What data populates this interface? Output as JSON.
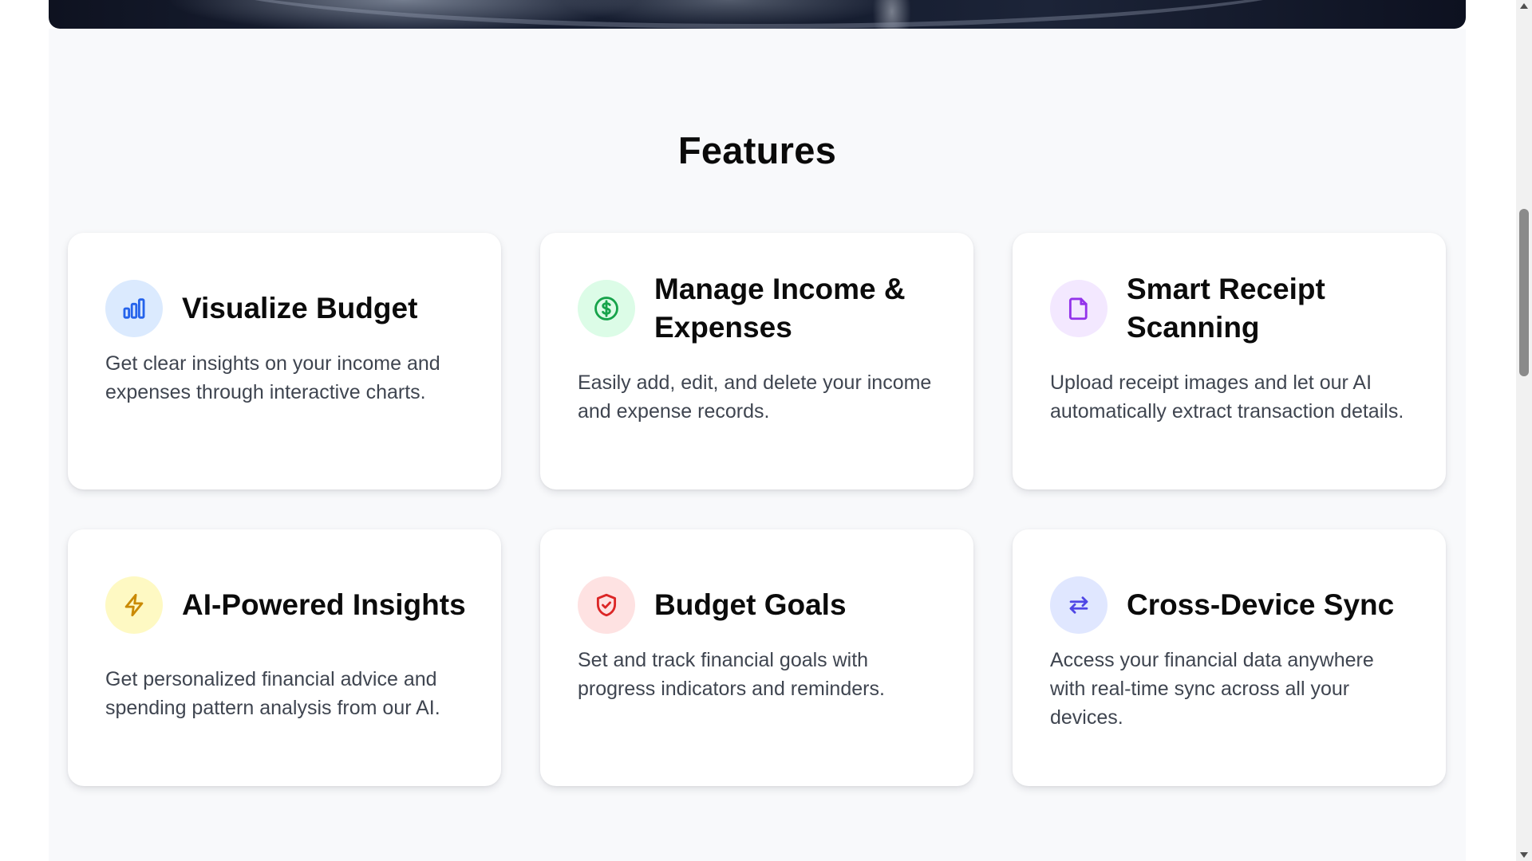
{
  "section": {
    "title": "Features"
  },
  "features": [
    {
      "title": "Visualize Budget",
      "description": "Get clear insights on your income and expenses through interactive charts.",
      "icon": "bar-chart-icon",
      "icon_color": "#2563eb",
      "icon_bg": "#dbeafe"
    },
    {
      "title": "Manage Income & Expenses",
      "description": "Easily add, edit, and delete your income and expense records.",
      "icon": "dollar-circle-icon",
      "icon_color": "#16a34a",
      "icon_bg": "#dcfce7"
    },
    {
      "title": "Smart Receipt Scanning",
      "description": "Upload receipt images and let our AI automatically extract transaction details.",
      "icon": "document-icon",
      "icon_color": "#9333ea",
      "icon_bg": "#f3e8ff"
    },
    {
      "title": "AI-Powered Insights",
      "description": "Get personalized financial advice and spending pattern analysis from our AI.",
      "icon": "lightning-icon",
      "icon_color": "#ca8a04",
      "icon_bg": "#fef9c3"
    },
    {
      "title": "Budget Goals",
      "description": "Set and track financial goals with progress indicators and reminders.",
      "icon": "shield-check-icon",
      "icon_color": "#dc2626",
      "icon_bg": "#fee2e2"
    },
    {
      "title": "Cross-Device Sync",
      "description": "Access your financial data anywhere with real-time sync across all your devices.",
      "icon": "sync-arrows-icon",
      "icon_color": "#4f46e5",
      "icon_bg": "#e0e7ff"
    }
  ]
}
